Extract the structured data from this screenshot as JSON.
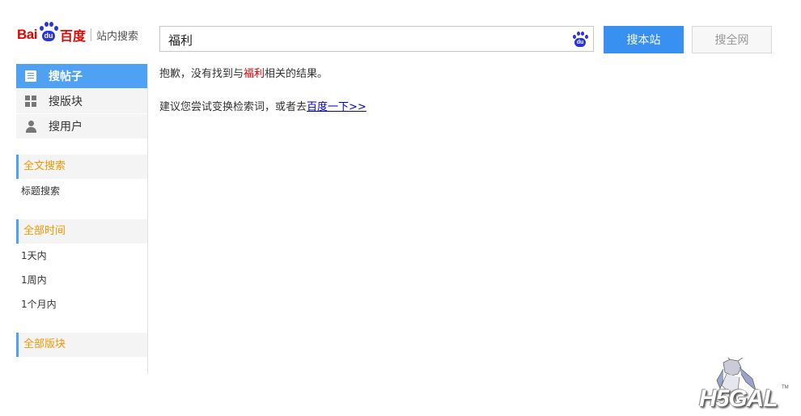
{
  "logo": {
    "bai": "Bai",
    "du": "du",
    "baidu_cn": "百度",
    "subtitle": "站内搜索"
  },
  "search": {
    "query": "福利",
    "btn_site": "搜本站",
    "btn_web": "搜全网"
  },
  "nav": [
    {
      "label": "搜帖子",
      "icon": "document-icon",
      "active": true
    },
    {
      "label": "搜版块",
      "icon": "grid-icon",
      "active": false
    },
    {
      "label": "搜用户",
      "icon": "user-icon",
      "active": false
    }
  ],
  "filters": {
    "scope": {
      "header": "全文搜索",
      "items": [
        "标题搜索"
      ]
    },
    "time": {
      "header": "全部时间",
      "items": [
        "1天内",
        "1周内",
        "1个月内"
      ]
    },
    "board": {
      "header": "全部版块"
    }
  },
  "result": {
    "msg_prefix": "抱歉，没有找到与",
    "keyword": "福利",
    "msg_suffix": "相关的结果。",
    "suggest_prefix": "建议您尝试变换检索词，或者去",
    "suggest_link": "百度一下>>"
  },
  "watermark": {
    "text": "H5GAL",
    "tm": "TM"
  },
  "colors": {
    "brand_red": "#e10602",
    "brand_blue": "#2932e1",
    "accent_blue": "#3890f0",
    "nav_active": "#4ea1f3",
    "filter_header": "#f39800",
    "keyword_red": "#cc0000",
    "link": "#0000cc"
  }
}
